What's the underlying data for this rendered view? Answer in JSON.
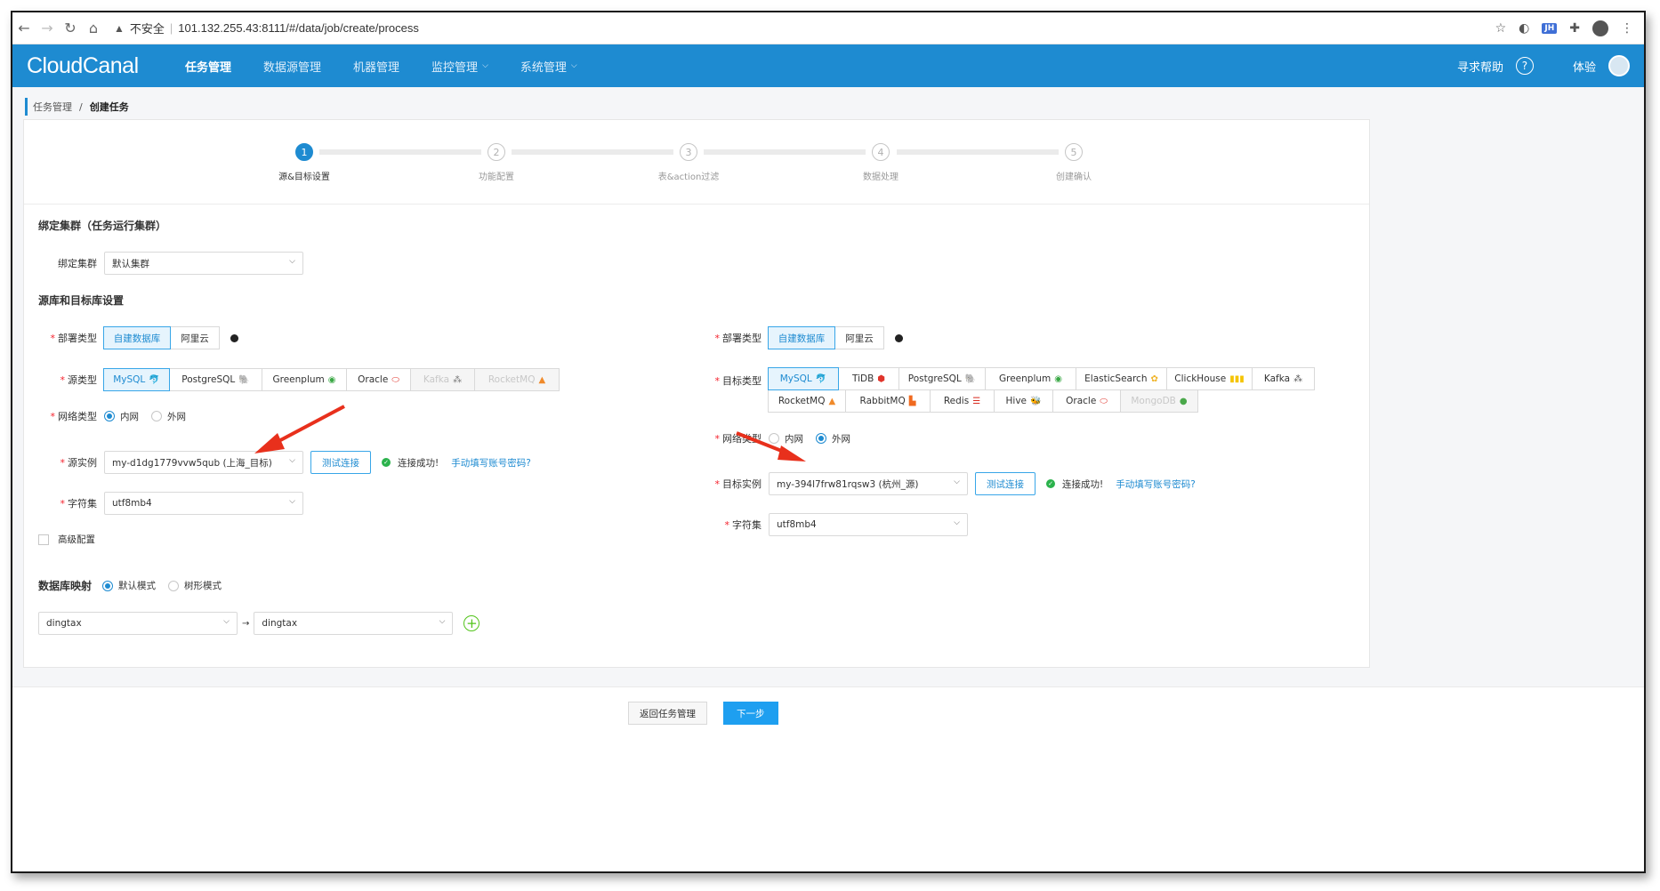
{
  "browser": {
    "security": "不安全",
    "url": "101.132.255.43:8111/#/data/job/create/process",
    "ext_label": "JH"
  },
  "header": {
    "logo": "CloudCanal",
    "menu": [
      {
        "label": "任务管理",
        "active": true,
        "caret": false
      },
      {
        "label": "数据源管理",
        "active": false,
        "caret": false
      },
      {
        "label": "机器管理",
        "active": false,
        "caret": false
      },
      {
        "label": "监控管理",
        "active": false,
        "caret": true
      },
      {
        "label": "系统管理",
        "active": false,
        "caret": true
      }
    ],
    "help": "寻求帮助",
    "user": "体验"
  },
  "breadcrumb": {
    "parent": "任务管理",
    "current": "创建任务"
  },
  "steps": [
    {
      "num": "1",
      "label": "源&目标设置"
    },
    {
      "num": "2",
      "label": "功能配置"
    },
    {
      "num": "3",
      "label": "表&action过滤"
    },
    {
      "num": "4",
      "label": "数据处理"
    },
    {
      "num": "5",
      "label": "创建确认"
    }
  ],
  "cluster": {
    "title": "绑定集群（任务运行集群）",
    "label": "绑定集群",
    "value": "默认集群"
  },
  "db_section_title": "源库和目标库设置",
  "source": {
    "deploy_label": "部署类型",
    "deploy_options": [
      "自建数据库",
      "阿里云"
    ],
    "type_label": "源类型",
    "types": [
      "MySQL",
      "PostgreSQL",
      "Greenplum",
      "Oracle",
      "Kafka",
      "RocketMQ"
    ],
    "network_label": "网络类型",
    "network_options": [
      "内网",
      "外网"
    ],
    "instance_label": "源实例",
    "instance_value": "my-d1dg1779vvw5qub (上海_目标)",
    "test_button": "测试连接",
    "status": "连接成功!",
    "manual_link": "手动填写账号密码?",
    "charset_label": "字符集",
    "charset_value": "utf8mb4",
    "advanced_label": "高级配置"
  },
  "target": {
    "deploy_label": "部署类型",
    "deploy_options": [
      "自建数据库",
      "阿里云"
    ],
    "type_label": "目标类型",
    "types_row1": [
      "MySQL",
      "TiDB",
      "PostgreSQL",
      "Greenplum",
      "ElasticSearch",
      "ClickHouse",
      "Kafka"
    ],
    "types_row2": [
      "RocketMQ",
      "RabbitMQ",
      "Redis",
      "Hive",
      "Oracle",
      "MongoDB"
    ],
    "network_label": "网络类型",
    "network_options": [
      "内网",
      "外网"
    ],
    "instance_label": "目标实例",
    "instance_value": "my-394l7frw81rqsw3 (杭州_源)",
    "test_button": "测试连接",
    "status": "连接成功!",
    "manual_link": "手动填写账号密码?",
    "charset_label": "字符集",
    "charset_value": "utf8mb4"
  },
  "mapping": {
    "label": "数据库映射",
    "mode_options": [
      "默认模式",
      "树形模式"
    ],
    "source_db": "dingtax",
    "target_db": "dingtax"
  },
  "footer": {
    "back_button": "返回任务管理",
    "next_button": "下一步"
  },
  "colors": {
    "brand": "#1e8bd1",
    "arrow": "#e8301c",
    "success": "#2bb24c"
  }
}
